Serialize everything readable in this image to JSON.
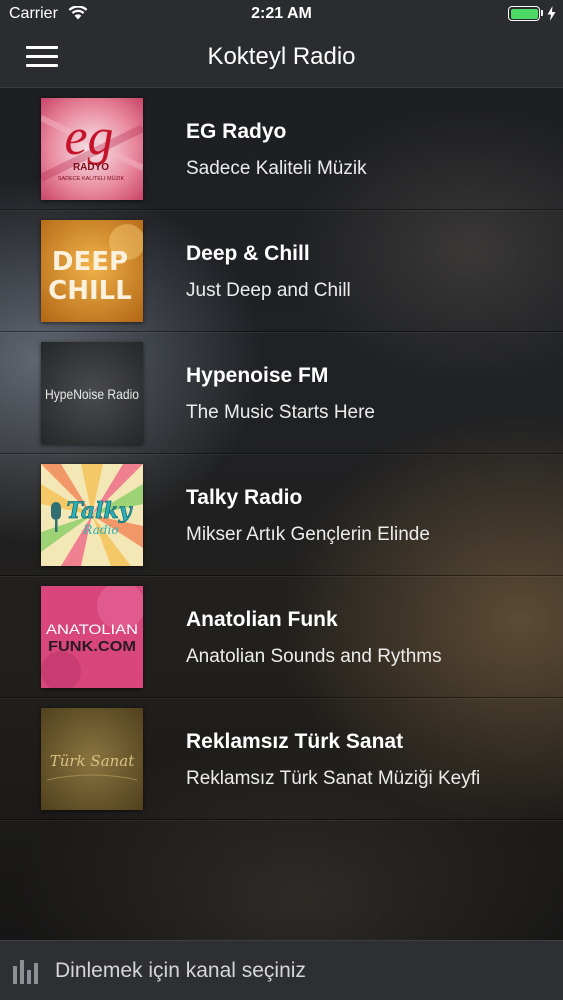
{
  "status_bar": {
    "carrier": "Carrier",
    "time": "2:21 AM",
    "battery_color": "#4cd964"
  },
  "nav": {
    "title": "Kokteyl Radio",
    "menu_icon": "hamburger-icon"
  },
  "stations": [
    {
      "title": "EG Radyo",
      "subtitle": "Sadece Kaliteli Müzik",
      "logo": {
        "line1": "eg",
        "line2": "RADYO",
        "line3": "SADECE KALITELI MÜZIK"
      }
    },
    {
      "title": "Deep & Chill",
      "subtitle": "Just Deep and Chill",
      "logo": {
        "line1": "DEEP",
        "line2": "CHILL"
      }
    },
    {
      "title": "Hypenoise FM",
      "subtitle": "The Music Starts Here",
      "logo": {
        "line1": "HypeNoise Radio"
      }
    },
    {
      "title": "Talky Radio",
      "subtitle": "Mikser Artık Gençlerin Elinde",
      "logo": {
        "line1": "Talky",
        "line2": "Radio"
      }
    },
    {
      "title": "Anatolian Funk",
      "subtitle": "Anatolian Sounds and Rythms",
      "logo": {
        "line1": "ANATOLIAN",
        "line2": "FUNK.COM"
      }
    },
    {
      "title": "Reklamsız Türk Sanat",
      "subtitle": "Reklamsız Türk Sanat Müziği Keyfi",
      "logo": {
        "line1": "Türk Sanat"
      }
    }
  ],
  "player": {
    "icon": "equalizer-icon",
    "status_text": "Dinlemek için kanal seçiniz"
  }
}
